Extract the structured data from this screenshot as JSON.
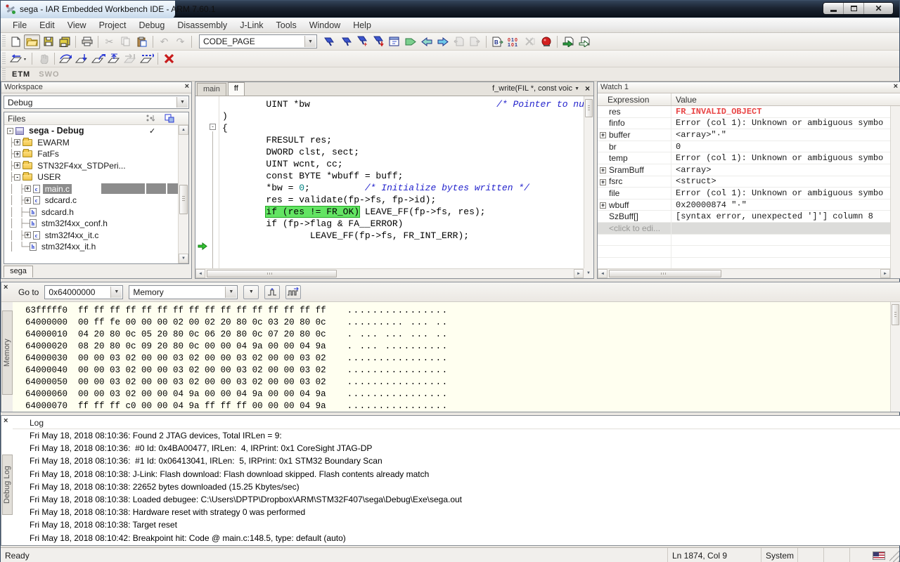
{
  "window": {
    "title": "sega - IAR Embedded Workbench IDE - ARM 7.60.1"
  },
  "icons": {
    "close": "×",
    "dropdown": "▼",
    "check": "✓",
    "cut": "✂",
    "undo": "↶",
    "redo": "↷",
    "up": "▲",
    "down": "▼",
    "left": "◄",
    "right": "►",
    "minus": "-",
    "stop": "✕"
  },
  "menu": {
    "items": [
      "File",
      "Edit",
      "View",
      "Project",
      "Debug",
      "Disassembly",
      "J-Link",
      "Tools",
      "Window",
      "Help"
    ]
  },
  "toolbar": {
    "code_page": "CODE_PAGE"
  },
  "etm": {
    "tabs": [
      "ETM",
      "SWO"
    ]
  },
  "workspace": {
    "title": "Workspace",
    "config": "Debug",
    "files_label": "Files",
    "bottom_tab": "sega",
    "tree": [
      {
        "e": "-",
        "label": "sega - Debug",
        "check": "✓"
      },
      {
        "p": "├",
        "e": "+",
        "label": "EWARM"
      },
      {
        "p": "├",
        "e": "+",
        "label": "FatFs"
      },
      {
        "p": "├",
        "e": "+",
        "label": "STN32F4xx_STDPeri..."
      },
      {
        "p": "├",
        "e": "-",
        "label": "USER"
      },
      {
        "p": "│ ├",
        "e": "+",
        "label": "main.c"
      },
      {
        "p": "│ ├",
        "e": "+",
        "label": "sdcard.c"
      },
      {
        "p": "│ ├─",
        "label": "sdcard.h"
      },
      {
        "p": "│ ├─",
        "label": "stm32f4xx_conf.h"
      },
      {
        "p": "│ ├",
        "e": "+",
        "label": "stm32f4xx_it.c"
      },
      {
        "p": "│ └─",
        "label": "stm32f4xx_it.h"
      }
    ]
  },
  "editor": {
    "tabs": [
      "main",
      "ff"
    ],
    "function_selector": "f_write(FIL *, const voic",
    "lines": [
      {
        "a": "        UINT *bw                                  ",
        "b": "/* Pointer to number of bytes writ"
      },
      {
        "a": ")"
      },
      {
        "a": "{"
      },
      {
        "a": ""
      },
      {
        "a": "        FRESULT res;"
      },
      {
        "a": "        DWORD clst, sect;"
      },
      {
        "a": "        UINT wcnt, cc;"
      },
      {
        "a": "        const BYTE *wbuff = buff;"
      },
      {
        "a": ""
      },
      {
        "a": "        *bw = ",
        "n": "0",
        "m": ";          ",
        "b": "/* Initialize bytes written */"
      },
      {
        "a": ""
      },
      {
        "a": "        res = validate(fp->fs, fp->id);                                  ",
        "b": "/*"
      },
      {
        "a": "        ",
        "h": "if (res != FR_OK)",
        "m": " LEAVE_FF(fp->fs, res);"
      },
      {
        "a": "        if (fp->flag & FA__ERROR)"
      },
      {
        "a": "                LEAVE_FF(fp->fs, FR_INT_ERR);"
      }
    ]
  },
  "watch": {
    "title": "Watch 1",
    "col_expression": "Expression",
    "col_value": "Value",
    "rows": [
      {
        "expr": "res",
        "value": "FR_INVALID_OBJECT"
      },
      {
        "expr": "finfo",
        "value": "Error (col 1): Unknown or ambiguous symbo"
      },
      {
        "e": "+",
        "expr": "buffer",
        "value": "<array>\"·\""
      },
      {
        "expr": "br",
        "value": "0"
      },
      {
        "expr": "temp",
        "value": "Error (col 1): Unknown or ambiguous symbo"
      },
      {
        "e": "+",
        "expr": "SramBuff",
        "value": "<array>"
      },
      {
        "e": "+",
        "expr": "fsrc",
        "value": "<struct>"
      },
      {
        "expr": "file",
        "value": "Error (col 1): Unknown or ambiguous symbo"
      },
      {
        "e": "+",
        "expr": "wbuff",
        "value": "0x20000874 \"·\""
      },
      {
        "expr": "SzBuff[]",
        "value": "[syntax error, unexpected ']'] column 8"
      },
      {
        "expr": "<click to edi..."
      }
    ]
  },
  "memory": {
    "goto_label": "Go to",
    "address": "0x64000000",
    "view": "Memory",
    "side_tab": "Memory",
    "rows": [
      {
        "addr": "63fffff0",
        "hex": "ff ff ff ff ff ff ff ff ff ff ff ff ff ff ff ff",
        "ascii": "................"
      },
      {
        "addr": "64000000",
        "hex": "00 ff fe 00 00 00 02 00 02 20 80 0c 03 20 80 0c",
        "ascii": "......... ... .."
      },
      {
        "addr": "64000010",
        "hex": "04 20 80 0c 05 20 80 0c 06 20 80 0c 07 20 80 0c",
        "ascii": ". ... ... ... .."
      },
      {
        "addr": "64000020",
        "hex": "08 20 80 0c 09 20 80 0c 00 00 04 9a 00 00 04 9a",
        "ascii": ". ... .........."
      },
      {
        "addr": "64000030",
        "hex": "00 00 03 02 00 00 03 02 00 00 03 02 00 00 03 02",
        "ascii": "................"
      },
      {
        "addr": "64000040",
        "hex": "00 00 03 02 00 00 03 02 00 00 03 02 00 00 03 02",
        "ascii": "................"
      },
      {
        "addr": "64000050",
        "hex": "00 00 03 02 00 00 03 02 00 00 03 02 00 00 03 02",
        "ascii": "................"
      },
      {
        "addr": "64000060",
        "hex": "00 00 03 02 00 00 04 9a 00 00 04 9a 00 00 04 9a",
        "ascii": "................"
      },
      {
        "addr": "64000070",
        "hex": "ff ff ff c0 00 00 04 9a ff ff ff 00 00 00 04 9a",
        "ascii": "................"
      }
    ]
  },
  "log": {
    "side_tab": "Debug Log",
    "header": "Log",
    "lines": [
      "Fri May 18, 2018 08:10:36: Found 2 JTAG devices, Total IRLen = 9:",
      "Fri May 18, 2018 08:10:36:  #0 Id: 0x4BA00477, IRLen:  4, IRPrint: 0x1 CoreSight JTAG-DP",
      "Fri May 18, 2018 08:10:36:  #1 Id: 0x06413041, IRLen:  5, IRPrint: 0x1 STM32 Boundary Scan",
      "Fri May 18, 2018 08:10:38: J-Link: Flash download: Flash download skipped. Flash contents already match",
      "Fri May 18, 2018 08:10:38: 22652 bytes downloaded (15.25 Kbytes/sec)",
      "Fri May 18, 2018 08:10:38: Loaded debugee: C:\\Users\\DPTP\\Dropbox\\ARM\\STM32F407\\sega\\Debug\\Exe\\sega.out",
      "Fri May 18, 2018 08:10:38: Hardware reset with strategy 0 was performed",
      "Fri May 18, 2018 08:10:38: Target reset",
      "Fri May 18, 2018 08:10:42: Breakpoint hit: Code @ main.c:148.5, type: default (auto)"
    ]
  },
  "status": {
    "ready": "Ready",
    "position": "Ln 1874, Col 9",
    "system": "System"
  }
}
